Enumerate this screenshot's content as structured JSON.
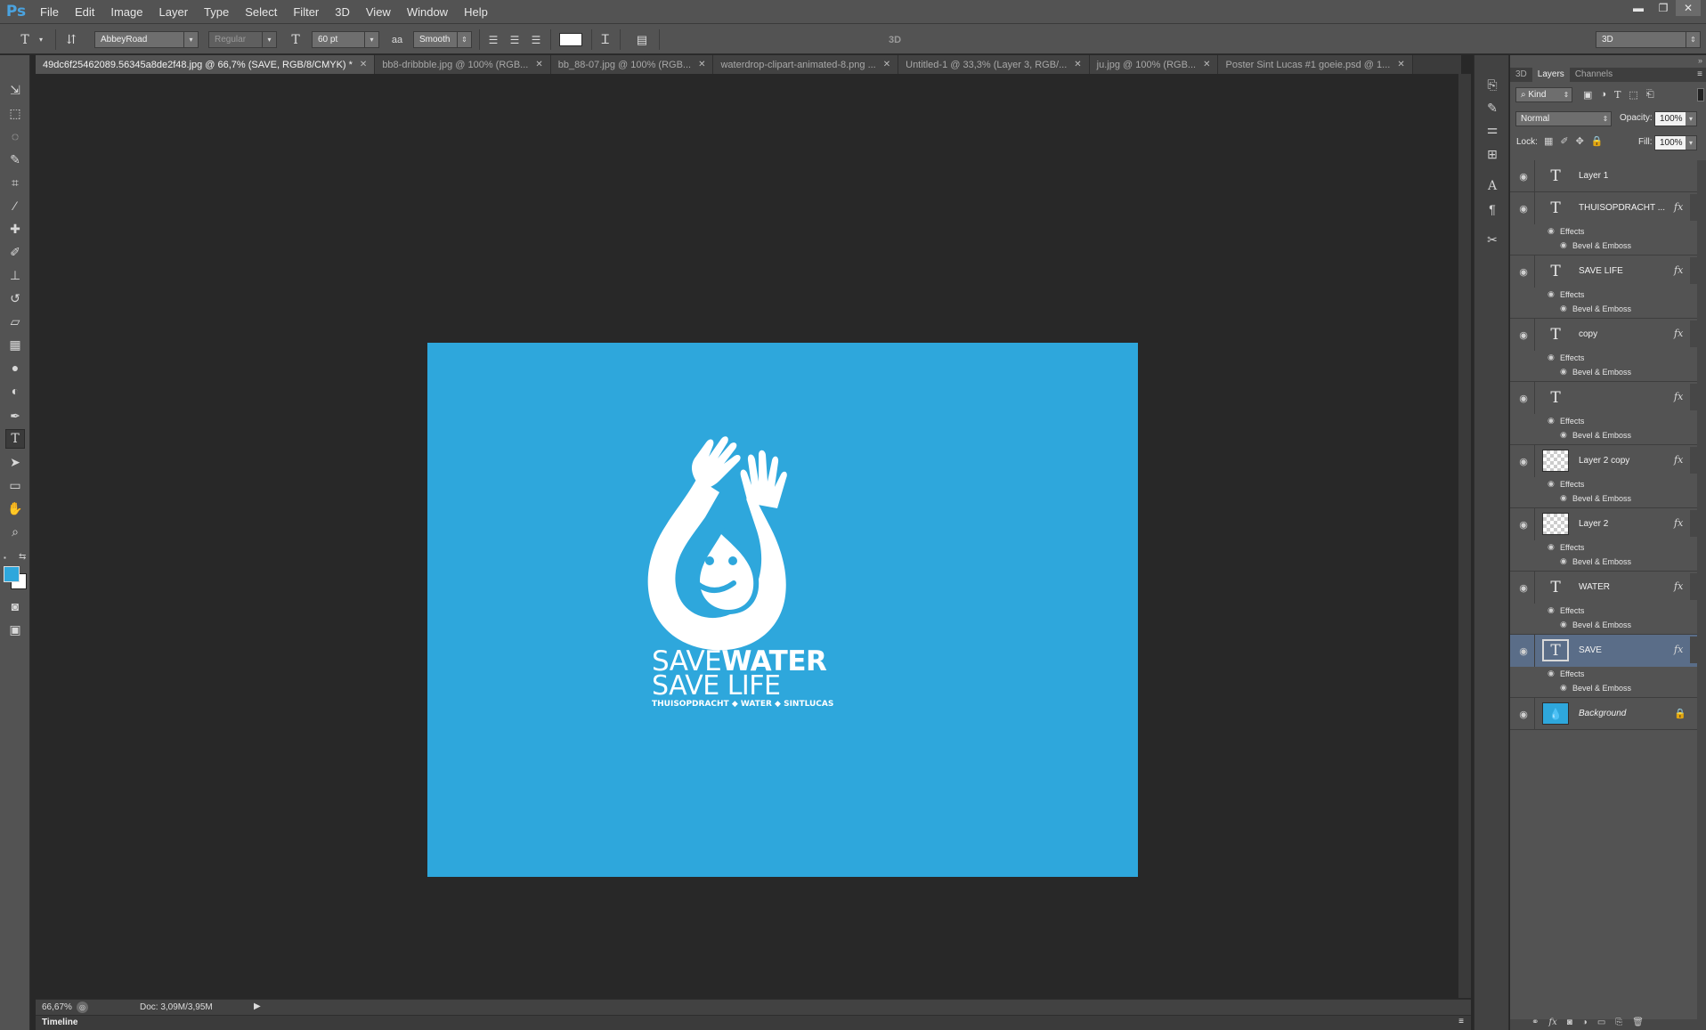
{
  "app": {
    "logo": "Ps"
  },
  "menu": [
    "File",
    "Edit",
    "Image",
    "Layer",
    "Type",
    "Select",
    "Filter",
    "3D",
    "View",
    "Window",
    "Help"
  ],
  "window_controls": {
    "minimize": "▬",
    "restore": "❐",
    "close": "✕"
  },
  "options_bar": {
    "font_family": "AbbeyRoad",
    "font_style": "Regular",
    "font_size": "60 pt",
    "antialias_icon": "aa",
    "antialias": "Smooth",
    "text_color": "#ffffff",
    "label_3d": "3D",
    "workspace": "3D"
  },
  "doc_tabs": [
    {
      "label": "49dc6f25462089.56345a8de2f48.jpg @ 66,7% (SAVE, RGB/8/CMYK) *",
      "active": true
    },
    {
      "label": "bb8-dribbble.jpg @ 100% (RGB...",
      "active": false
    },
    {
      "label": "bb_88-07.jpg @ 100% (RGB...",
      "active": false
    },
    {
      "label": "waterdrop-clipart-animated-8.png ...",
      "active": false
    },
    {
      "label": "Untitled-1 @ 33,3% (Layer 3, RGB/...",
      "active": false
    },
    {
      "label": "ju.jpg @ 100% (RGB...",
      "active": false
    },
    {
      "label": "Poster Sint Lucas #1 goeie.psd @ 1...",
      "active": false
    }
  ],
  "artwork": {
    "background_color": "#2ea7dc",
    "line1_a": "SAVE",
    "line1_b": "WATER",
    "line2": "SAVE LIFE",
    "line3": "THUISOPDRACHT ◆ WATER ◆ SINTLUCAS"
  },
  "status": {
    "zoom": "66,67%",
    "doc": "Doc: 3,09M/3,95M"
  },
  "timeline_label": "Timeline",
  "panel": {
    "tabs": [
      "3D",
      "Layers",
      "Channels"
    ],
    "active_tab": "Layers",
    "filter_kind": "Kind",
    "blend_mode": "Normal",
    "opacity_label": "Opacity:",
    "opacity": "100%",
    "lock_label": "Lock:",
    "fill_label": "Fill:",
    "fill": "100%"
  },
  "layers": [
    {
      "name": "Layer 1",
      "type": "text",
      "fx": false,
      "effects": []
    },
    {
      "name": "THUISOPDRACHT ...",
      "type": "text",
      "fx": true,
      "effects": [
        "Effects",
        "Bevel & Emboss"
      ]
    },
    {
      "name": "SAVE LIFE",
      "type": "text",
      "fx": true,
      "effects": [
        "Effects",
        "Bevel & Emboss"
      ]
    },
    {
      "name": "copy",
      "type": "text",
      "fx": true,
      "effects": [
        "Effects",
        "Bevel & Emboss"
      ]
    },
    {
      "name": "",
      "type": "text",
      "fx": true,
      "effects": [
        "Effects",
        "Bevel & Emboss"
      ]
    },
    {
      "name": "Layer 2 copy",
      "type": "pixel",
      "fx": true,
      "effects": [
        "Effects",
        "Bevel & Emboss"
      ]
    },
    {
      "name": "Layer 2",
      "type": "pixel",
      "fx": true,
      "effects": [
        "Effects",
        "Bevel & Emboss"
      ]
    },
    {
      "name": "WATER",
      "type": "text",
      "fx": true,
      "effects": [
        "Effects",
        "Bevel & Emboss"
      ]
    },
    {
      "name": "SAVE",
      "type": "text",
      "fx": true,
      "selected": true,
      "effects": [
        "Effects",
        "Bevel & Emboss"
      ]
    },
    {
      "name": "Background",
      "type": "background",
      "fx": false,
      "locked": true,
      "effects": []
    }
  ],
  "glyphs": {
    "fx": "fx",
    "eye": "◉",
    "lock": "🔒",
    "text_thumb": "T",
    "bg_thumb": "💧"
  }
}
